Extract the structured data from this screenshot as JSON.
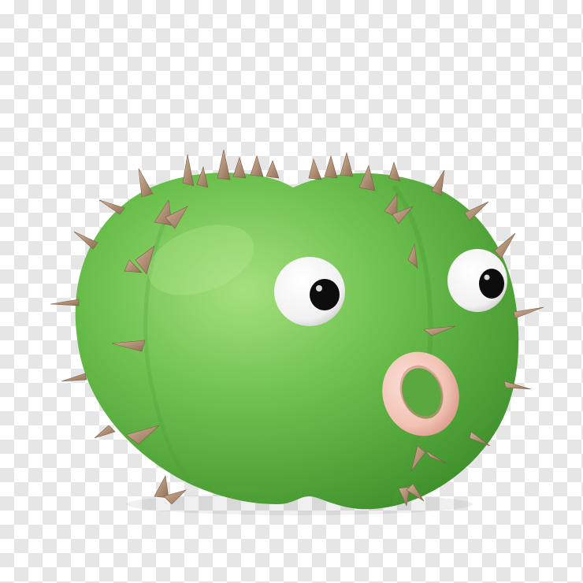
{
  "image": {
    "subject": "cactus-character",
    "background": "transparency-checkerboard",
    "colors": {
      "body": "#6cc04d",
      "body_shadow": "#3e8f2b",
      "body_highlight": "#a6e07f",
      "spine": "#b8967a",
      "spine_dark": "#8e6d55",
      "eye_white": "#ffffff",
      "pupil": "#0d0d0d",
      "mouth": "#f2c2b4",
      "mouth_shadow": "#d89a8a",
      "checker_light": "#ffffff",
      "checker_dark": "#e6e6e6"
    }
  }
}
